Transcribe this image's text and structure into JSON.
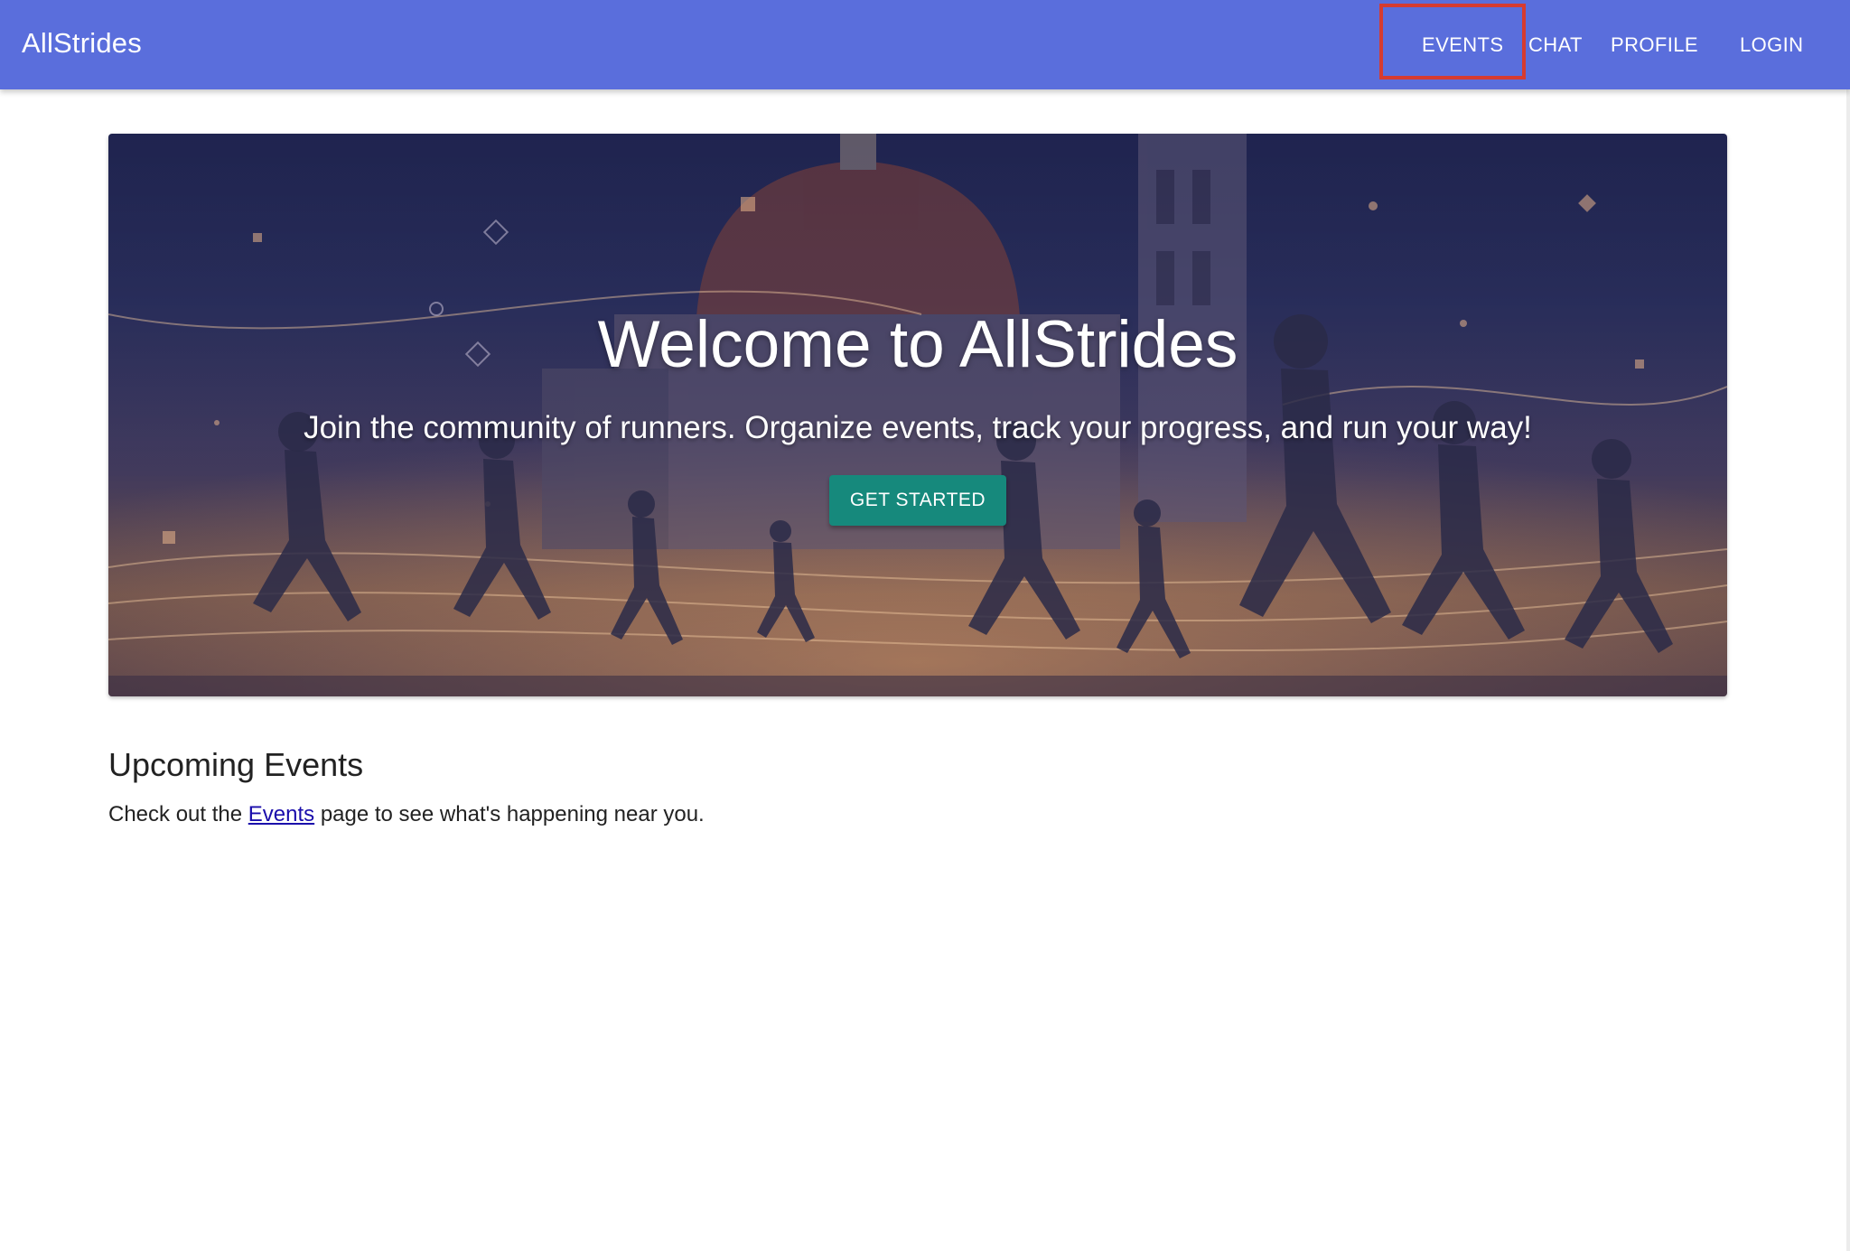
{
  "appbar": {
    "brand": "AllStrides",
    "nav": [
      {
        "label": "EVENTS"
      },
      {
        "label": "CHAT"
      },
      {
        "label": "PROFILE"
      },
      {
        "label": "LOGIN"
      }
    ],
    "color": "#5a6edc",
    "highlight_color": "#d63b30"
  },
  "hero": {
    "title": "Welcome to AllStrides",
    "subtitle": "Join the community of runners. Organize events, track your progress, and run your way!",
    "button_label": "GET STARTED",
    "button_color": "#16897c"
  },
  "upcoming": {
    "heading": "Upcoming Events",
    "text_before": "Check out the",
    "link_label": "Events",
    "text_after": "page to see what's happening near you."
  }
}
